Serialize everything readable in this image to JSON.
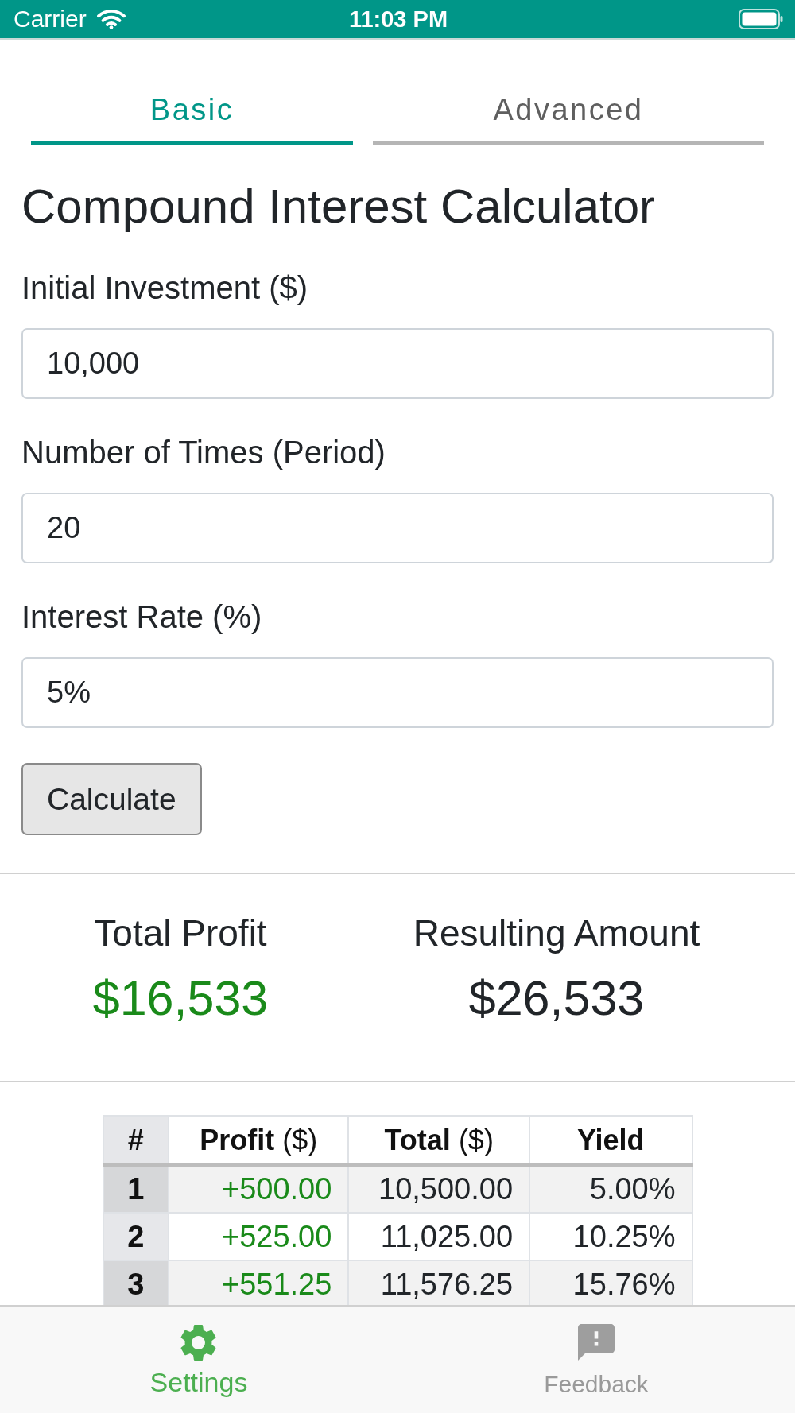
{
  "status_bar": {
    "carrier": "Carrier",
    "time": "11:03 PM"
  },
  "tabs": [
    {
      "label": "Basic",
      "selected": true
    },
    {
      "label": "Advanced",
      "selected": false
    }
  ],
  "title": "Compound Interest Calculator",
  "fields": [
    {
      "label": "Initial Investment ($)",
      "value": "10,000"
    },
    {
      "label": "Number of Times (Period)",
      "value": "20"
    },
    {
      "label": "Interest Rate (%)",
      "value": "5%"
    }
  ],
  "calculate_button": {
    "label": "Calculate"
  },
  "results": [
    {
      "kind": "profit",
      "label": "Total Profit",
      "value": "$16,533"
    },
    {
      "kind": "amount",
      "label": "Resulting Amount",
      "value": "$26,533"
    }
  ],
  "table": {
    "columns": [
      {
        "title": "#"
      },
      {
        "title": "Profit",
        "unit": "($)"
      },
      {
        "title": "Total",
        "unit": "($)"
      },
      {
        "title": "Yield"
      }
    ],
    "rows": [
      {
        "number": "1",
        "profit": "+500.00",
        "total": "10,500.00",
        "yield": "5.00%"
      },
      {
        "number": "2",
        "profit": "+525.00",
        "total": "11,025.00",
        "yield": "10.25%"
      },
      {
        "number": "3",
        "profit": "+551.25",
        "total": "11,576.25",
        "yield": "15.76%"
      }
    ]
  },
  "bottom_tabs": [
    {
      "kind": "settings",
      "label": "Settings",
      "selected": true
    },
    {
      "kind": "feedback",
      "label": "Feedback",
      "selected": false
    }
  ]
}
